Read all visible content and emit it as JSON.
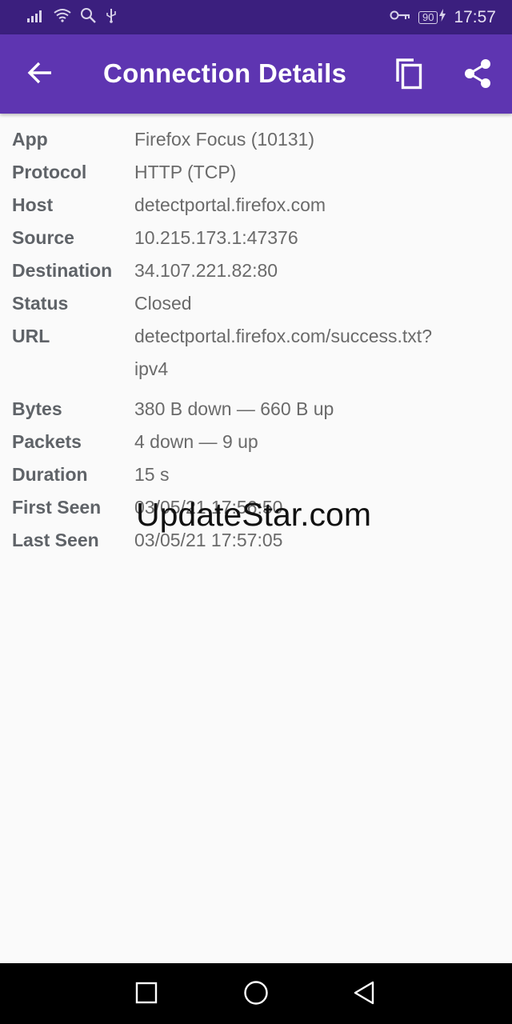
{
  "status_bar": {
    "time": "17:57",
    "battery": "90",
    "icons": [
      "signal-icon",
      "wifi-icon",
      "search-icon",
      "usb-icon",
      "vpn-key-icon",
      "battery-icon",
      "charging-icon"
    ]
  },
  "app_bar": {
    "title": "Connection Details",
    "back_icon": "arrow-back-icon",
    "copy_icon": "copy-icon",
    "share_icon": "share-icon"
  },
  "details": {
    "rows": [
      {
        "label": "App",
        "value": "Firefox Focus (10131)"
      },
      {
        "label": "Protocol",
        "value": "HTTP (TCP)"
      },
      {
        "label": "Host",
        "value": "detectportal.firefox.com"
      },
      {
        "label": "Source",
        "value": "10.215.173.1:47376"
      },
      {
        "label": "Destination",
        "value": "34.107.221.82:80"
      },
      {
        "label": "Status",
        "value": "Closed"
      },
      {
        "label": "URL",
        "value": "detectportal.firefox.com/success.txt?",
        "value2": "ipv4"
      },
      {
        "label": "Bytes",
        "value": "380 B down — 660 B up"
      },
      {
        "label": "Packets",
        "value": "4 down — 9 up"
      },
      {
        "label": "Duration",
        "value": "15 s"
      },
      {
        "label": "First Seen",
        "value": "03/05/21 17:56:50"
      },
      {
        "label": "Last Seen",
        "value": "03/05/21 17:57:05"
      }
    ]
  },
  "watermark": "UpdateStar.com",
  "nav_bar": {
    "icons": [
      "recents-square-icon",
      "home-circle-icon",
      "back-triangle-icon"
    ]
  },
  "colors": {
    "status_bar": "#3b1f7e",
    "app_bar": "#5e35b1",
    "background": "#fafafa",
    "label": "#5f6368",
    "value": "#6a6a6a"
  }
}
